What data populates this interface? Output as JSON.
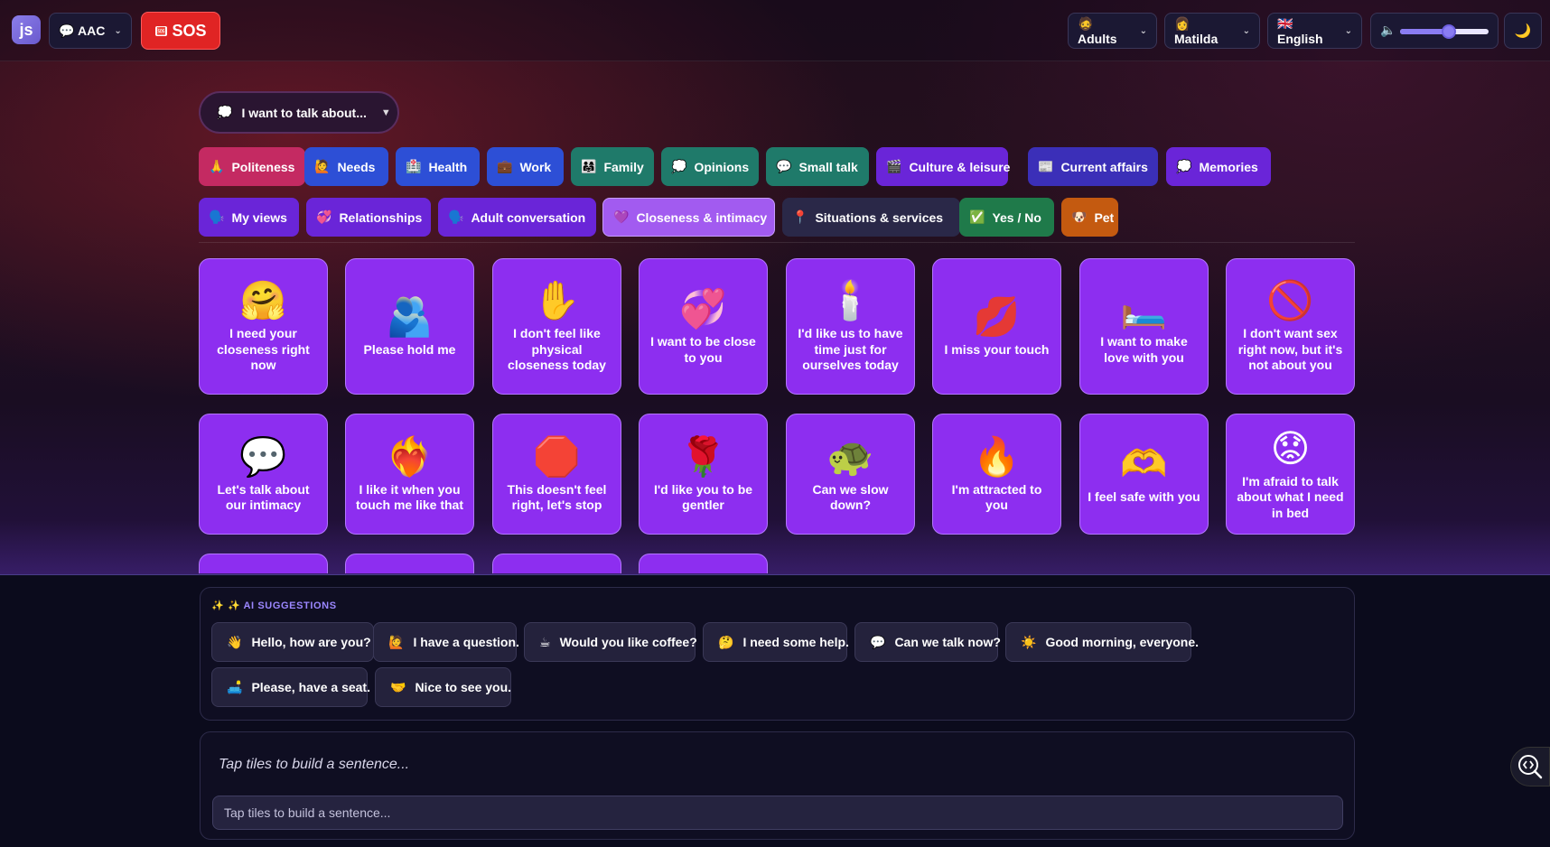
{
  "app": {
    "logo": "js",
    "mode_label": "💬 AAC",
    "sos_tag": "🆘",
    "sos_label": "SOS",
    "audience_label": "🧔 Adults",
    "user_label": "👩 Matilda",
    "language_label": "🇬🇧 English",
    "volume_level": 0.55,
    "volume_icon": "🔈",
    "theme_icon": "🌙"
  },
  "topic": {
    "icon": "💭",
    "label": "I want to talk about...",
    "caret": "▼"
  },
  "categories": [
    {
      "icon": "🙏",
      "label": "Politeness",
      "color": "#c42a62"
    },
    {
      "icon": "🙋",
      "label": "Needs",
      "color": "#2d4fd6"
    },
    {
      "icon": "🏥",
      "label": "Health",
      "color": "#2d4fd6"
    },
    {
      "icon": "💼",
      "label": "Work",
      "color": "#2d4fd6"
    },
    {
      "icon": "👨‍👩‍👧",
      "label": "Family",
      "color": "#1f7a6a"
    },
    {
      "icon": "💭",
      "label": "Opinions",
      "color": "#1f7a6a"
    },
    {
      "icon": "💬",
      "label": "Small talk",
      "color": "#1f7a6a"
    },
    {
      "icon": "🎬",
      "label": "Culture & leisure",
      "color": "#6a25d8"
    },
    {
      "icon": "📰",
      "label": "Current affairs",
      "color": "#3b2fb8"
    },
    {
      "icon": "💭",
      "label": "Memories",
      "color": "#6a25d8"
    },
    {
      "icon": "🗣️",
      "label": "My views",
      "color": "#6a25d8"
    },
    {
      "icon": "💞",
      "label": "Relationships",
      "color": "#6a25d8"
    },
    {
      "icon": "🗣️",
      "label": "Adult conversation",
      "color": "#6a25d8"
    },
    {
      "icon": "💜",
      "label": "Closeness & intimacy",
      "color": "#a25bf0"
    },
    {
      "icon": "📍",
      "label": "Situations & services",
      "color": "#2a2848"
    },
    {
      "icon": "✅",
      "label": "Yes / No",
      "color": "#1f7a4a"
    },
    {
      "icon": "🐶",
      "label": "Pet",
      "color": "#c45a10"
    }
  ],
  "tiles": [
    {
      "emoji": "🤗",
      "label": "I need your closeness right now"
    },
    {
      "emoji": "🫂",
      "label": "Please hold me"
    },
    {
      "emoji": "✋",
      "label": "I don't feel like physical closeness today"
    },
    {
      "emoji": "💞",
      "label": "I want to be close to you"
    },
    {
      "emoji": "🕯️",
      "label": "I'd like us to have time just for ourselves today"
    },
    {
      "emoji": "💋",
      "label": "I miss your touch"
    },
    {
      "emoji": "🛏️",
      "label": "I want to make love with you"
    },
    {
      "emoji": "🚫",
      "label": "I don't want sex right now, but it's not about you"
    },
    {
      "emoji": "💬",
      "label": "Let's talk about our intimacy"
    },
    {
      "emoji": "❤️‍🔥",
      "label": "I like it when you touch me like that"
    },
    {
      "emoji": "🛑",
      "label": "This doesn't feel right, let's stop"
    },
    {
      "emoji": "🌹",
      "label": "I'd like you to be gentler"
    },
    {
      "emoji": "🐢",
      "label": "Can we slow down?"
    },
    {
      "emoji": "🔥",
      "label": "I'm attracted to you"
    },
    {
      "emoji": "🫶",
      "label": "I feel safe with you"
    },
    {
      "emoji": "😟",
      "label": "I'm afraid to talk about what I need in bed"
    }
  ],
  "ai": {
    "title": "✨ ✨ AI SUGGESTIONS",
    "suggestions": [
      {
        "icon": "👋",
        "label": "Hello, how are you?"
      },
      {
        "icon": "🙋",
        "label": "I have a question."
      },
      {
        "icon": "☕",
        "label": "Would you like coffee?"
      },
      {
        "icon": "🤔",
        "label": "I need some help."
      },
      {
        "icon": "💬",
        "label": "Can we talk now?"
      },
      {
        "icon": "☀️",
        "label": "Good morning, everyone."
      },
      {
        "icon": "🛋️",
        "label": "Please, have a seat."
      },
      {
        "icon": "🤝",
        "label": "Nice to see you."
      }
    ]
  },
  "compose": {
    "display_text": "Tap tiles to build a sentence...",
    "input_placeholder": "Tap tiles to build a sentence..."
  }
}
